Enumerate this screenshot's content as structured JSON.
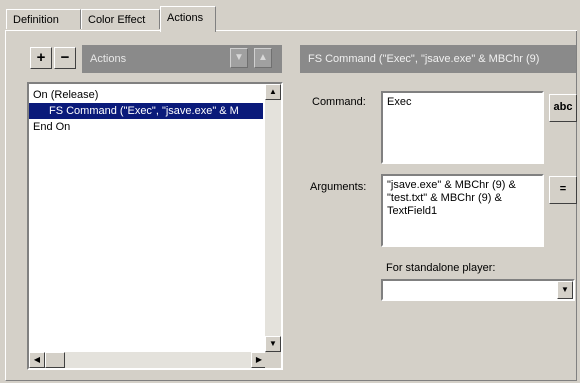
{
  "tabs": [
    {
      "label": "Definition"
    },
    {
      "label": "Color Effect"
    },
    {
      "label": "Actions"
    }
  ],
  "toolbar": {
    "add_label": "+",
    "remove_label": "−",
    "actions_title": "Actions",
    "move_down_glyph": "▼",
    "move_up_glyph": "▲"
  },
  "script": {
    "lines": [
      "On (Release)",
      "FS Command (\"Exec\", \"jsave.exe\" & M",
      "End On"
    ],
    "selected_index": 1
  },
  "right_panel": {
    "header": "FS Command (\"Exec\", \"jsave.exe\" & MBChr (9)",
    "command_label": "Command:",
    "command_value": "Exec",
    "command_btn": "abc",
    "arguments_label": "Arguments:",
    "arguments_value": "\"jsave.exe\" & MBChr (9) &\n\"test.txt\" & MBChr (9) &\nTextField1",
    "arguments_btn": "=",
    "standalone_label": "For standalone player:",
    "standalone_value": ""
  },
  "scroll_glyphs": {
    "up": "▲",
    "down": "▼",
    "left": "◀",
    "right": "▶"
  }
}
